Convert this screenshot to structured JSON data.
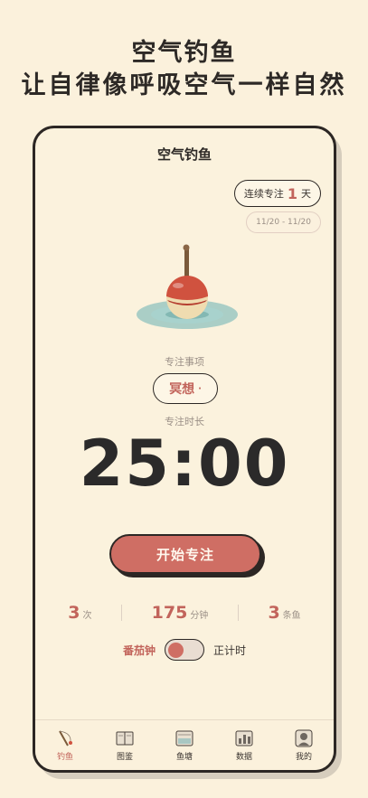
{
  "headline": {
    "line1": "空气钓鱼",
    "line2": "让自律像呼吸空气一样自然"
  },
  "app": {
    "title": "空气钓鱼",
    "streak": {
      "prefix": "连续专注",
      "count": "1",
      "suffix": "天"
    },
    "date_range": "11/20 - 11/20",
    "task_label": "专注事项",
    "task_value": "冥想",
    "task_dot": "·",
    "duration_label": "专注时长",
    "timer": "25:00",
    "start_button": "开始专注",
    "stats": [
      {
        "value": "3",
        "unit": "次"
      },
      {
        "value": "175",
        "unit": "分钟"
      },
      {
        "value": "3",
        "unit": "条鱼"
      }
    ],
    "mode": {
      "left": "番茄钟",
      "right": "正计时",
      "on_left": true
    },
    "tabs": [
      {
        "label": "钓鱼",
        "icon": "fishing-rod-icon",
        "active": true
      },
      {
        "label": "图鉴",
        "icon": "book-icon",
        "active": false
      },
      {
        "label": "鱼塘",
        "icon": "pond-icon",
        "active": false
      },
      {
        "label": "数据",
        "icon": "chart-icon",
        "active": false
      },
      {
        "label": "我的",
        "icon": "profile-icon",
        "active": false
      }
    ],
    "colors": {
      "accent": "#cf6e64",
      "background": "#fbf1dc",
      "ink": "#2c2724"
    }
  }
}
